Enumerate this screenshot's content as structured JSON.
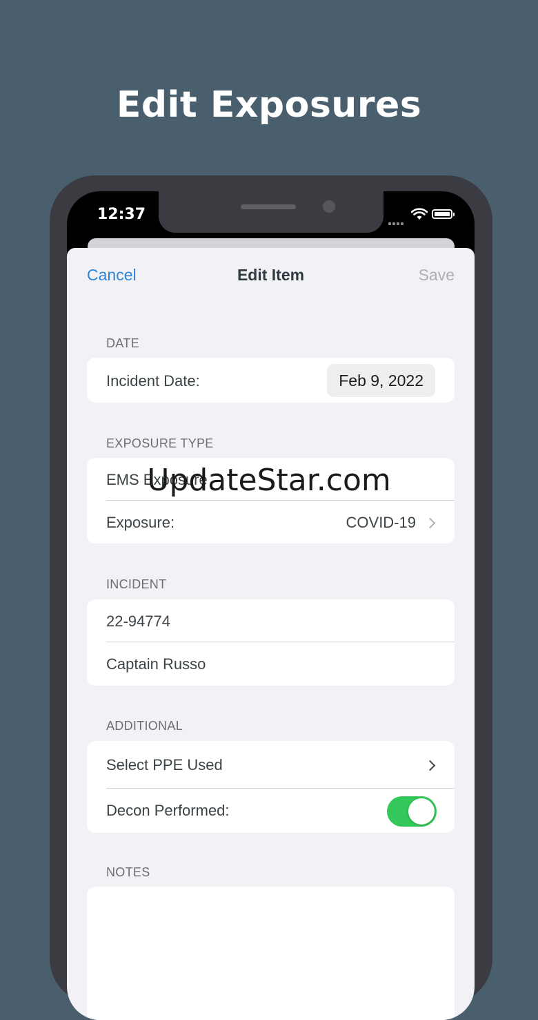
{
  "headline": "Edit Exposures",
  "status_bar": {
    "time": "12:37"
  },
  "navbar": {
    "cancel_label": "Cancel",
    "title": "Edit Item",
    "save_label": "Save"
  },
  "sections": {
    "date": {
      "header": "DATE",
      "incident_date_label": "Incident Date:",
      "incident_date_value": "Feb 9, 2022"
    },
    "exposure_type": {
      "header": "EXPOSURE TYPE",
      "category": "EMS Exposure",
      "exposure_label": "Exposure:",
      "exposure_value": "COVID-19"
    },
    "incident": {
      "header": "INCIDENT",
      "number": "22-94774",
      "officer": "Captain Russo"
    },
    "additional": {
      "header": "ADDITIONAL",
      "ppe_label": "Select PPE Used",
      "decon_label": "Decon Performed:",
      "decon_on": true
    },
    "notes": {
      "header": "NOTES",
      "text": ""
    }
  },
  "watermark": "UpdateStar.com",
  "colors": {
    "background": "#4a5f6e",
    "accent": "#2f86d6",
    "toggle_on": "#34c759"
  }
}
